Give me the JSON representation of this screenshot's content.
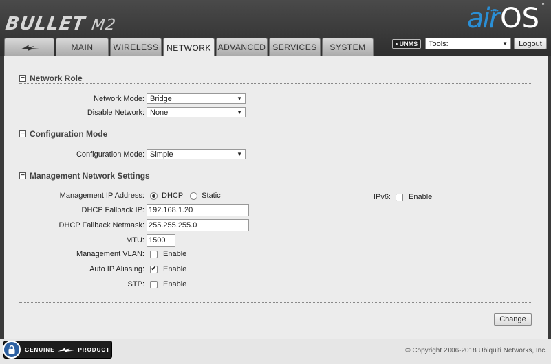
{
  "header": {
    "brand": "BULLET",
    "model": "M2",
    "logo_air": "air",
    "logo_os": "OS",
    "logo_tm": "™"
  },
  "tabs": [
    {
      "label": "",
      "icon": "ubiquiti-logo-icon"
    },
    {
      "label": "MAIN"
    },
    {
      "label": "WIRELESS"
    },
    {
      "label": "NETWORK",
      "active": true
    },
    {
      "label": "ADVANCED"
    },
    {
      "label": "SERVICES"
    },
    {
      "label": "SYSTEM"
    }
  ],
  "toolbar": {
    "unms_badge": "UNMS",
    "tools_value": "Tools:",
    "logout_label": "Logout"
  },
  "network_role": {
    "title": "Network Role",
    "network_mode_label": "Network Mode:",
    "network_mode_value": "Bridge",
    "disable_network_label": "Disable Network:",
    "disable_network_value": "None"
  },
  "configuration_mode": {
    "title": "Configuration Mode",
    "label": "Configuration Mode:",
    "value": "Simple"
  },
  "management": {
    "title": "Management Network Settings",
    "ip_address_label": "Management IP Address:",
    "dhcp_label": "DHCP",
    "static_label": "Static",
    "dhcp_selected": true,
    "fallback_ip_label": "DHCP Fallback IP:",
    "fallback_ip_value": "192.168.1.20",
    "fallback_netmask_label": "DHCP Fallback Netmask:",
    "fallback_netmask_value": "255.255.255.0",
    "mtu_label": "MTU:",
    "mtu_value": "1500",
    "vlan_label": "Management VLAN:",
    "vlan_enable": "Enable",
    "vlan_checked": false,
    "auto_ip_label": "Auto IP Aliasing:",
    "auto_ip_enable": "Enable",
    "auto_ip_checked": true,
    "stp_label": "STP:",
    "stp_enable": "Enable",
    "stp_checked": false,
    "ipv6_label": "IPv6:",
    "ipv6_enable": "Enable",
    "ipv6_checked": false
  },
  "actions": {
    "change_label": "Change"
  },
  "footer": {
    "genuine_left": "GENUINE",
    "genuine_right": "PRODUCT",
    "copyright": "© Copyright 2006-2018 Ubiquiti Networks, Inc."
  }
}
